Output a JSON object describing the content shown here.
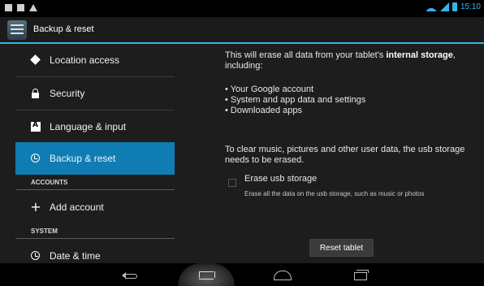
{
  "status_bar": {
    "left_icons": [
      "gallery-notification-icon",
      "photo-notification-icon",
      "warning-notification-icon"
    ],
    "clock": "15:10",
    "accent_color": "#33b5e5"
  },
  "action_bar": {
    "title": "Backup & reset"
  },
  "sidebar": {
    "items": [
      {
        "label": "Location access",
        "icon": "location-icon"
      },
      {
        "label": "Security",
        "icon": "lock-icon"
      },
      {
        "label": "Language & input",
        "icon": "language-icon"
      },
      {
        "label": "Backup & reset",
        "icon": "backup-icon",
        "selected": true
      }
    ],
    "accounts_header": "ACCOUNTS",
    "add_account": "Add account",
    "system_header": "SYSTEM",
    "date_time": "Date & time",
    "selected_color": "#0f7cb4"
  },
  "content": {
    "intro_prefix": "This will erase all data from your tablet's ",
    "intro_bold": "internal storage",
    "intro_suffix": ", including:",
    "bullets": [
      "Your Google account",
      "System and app data and settings",
      "Downloaded apps"
    ],
    "usb_note": "To clear music, pictures and other user data, the usb storage needs to be erased.",
    "erase_usb_label": "Erase usb storage",
    "erase_usb_checked": false,
    "erase_usb_summary": "Erase all the data on the usb storage, such as music or photos",
    "reset_button": "Reset tablet"
  },
  "nav_bar": {
    "buttons": [
      "back-icon",
      "screenshot-icon",
      "home-icon",
      "recent-apps-icon"
    ]
  }
}
